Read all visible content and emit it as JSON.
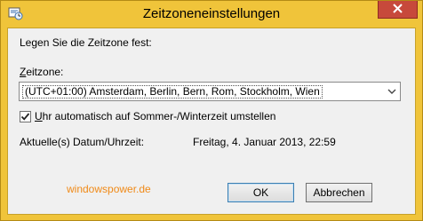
{
  "window": {
    "title": "Zeitzoneneinstellungen",
    "icon": "clock-settings-icon",
    "close_icon": "close-icon"
  },
  "dialog": {
    "prompt": "Legen Sie die Zeitzone fest:",
    "timezone_label_accel": "Z",
    "timezone_label_rest": "eitzone:",
    "timezone_value": "(UTC+01:00) Amsterdam, Berlin, Bern, Rom, Stockholm, Wien",
    "dst_checked": true,
    "dst_label_accel": "U",
    "dst_label_rest": "hr automatisch auf Sommer-/Winterzeit umstellen",
    "datetime_label": "Aktuelle(s) Datum/Uhrzeit:",
    "datetime_value": "Freitag, 4. Januar 2013, 22:59",
    "watermark": "windowspower.de"
  },
  "buttons": {
    "ok": "OK",
    "cancel": "Abbrechen"
  },
  "colors": {
    "frame": "#f0c43a",
    "close_button": "#c7493b",
    "client_background": "#f0f0f0",
    "watermark": "#f08a18"
  }
}
